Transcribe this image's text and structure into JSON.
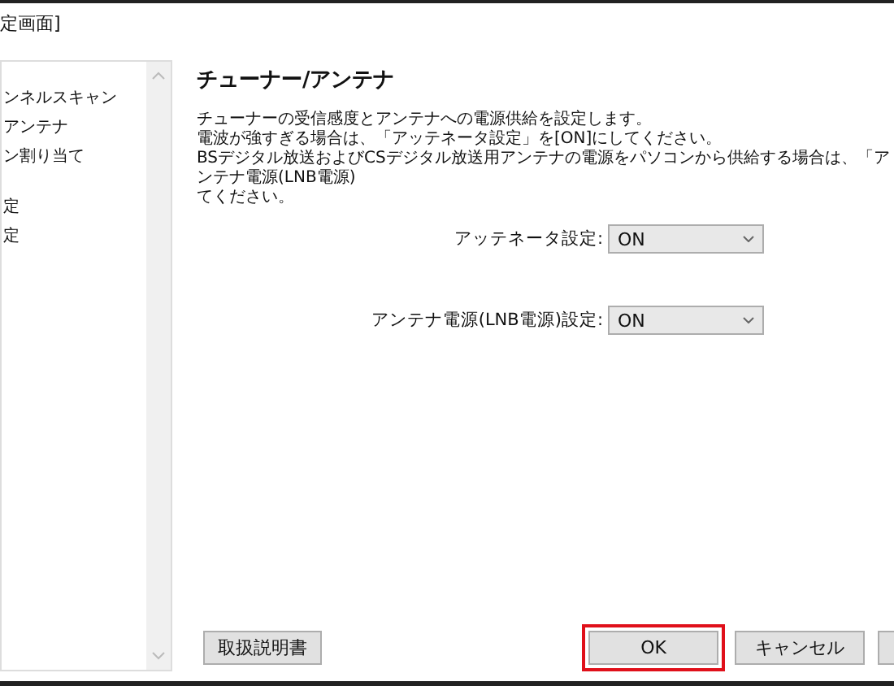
{
  "window": {
    "title": "定画面]"
  },
  "sidebar": {
    "groups": [
      [
        {
          "label": "ンネルスキャン"
        },
        {
          "label": "アンテナ"
        },
        {
          "label": "ン割り当て"
        }
      ],
      [
        {
          "label": "定"
        },
        {
          "label": "定"
        }
      ]
    ]
  },
  "content": {
    "heading": "チューナー/アンテナ",
    "description": [
      "チューナーの受信感度とアンテナへの電源供給を設定します。",
      "電波が強すぎる場合は、「アッテネータ設定」を[ON]にしてください。",
      "BSデジタル放送およびCSデジタル放送用アンテナの電源をパソコンから供給する場合は、「アンテナ電源(LNB電源)",
      "てください。"
    ],
    "settings": [
      {
        "label": "アッテネータ設定:",
        "value": "ON"
      },
      {
        "label": "アンテナ電源(LNB電源)設定:",
        "value": "ON"
      }
    ]
  },
  "footer": {
    "manual_button": "取扱説明書",
    "buttons": [
      {
        "label": "OK",
        "highlighted": true
      },
      {
        "label": "キャンセル",
        "highlighted": false
      }
    ]
  }
}
